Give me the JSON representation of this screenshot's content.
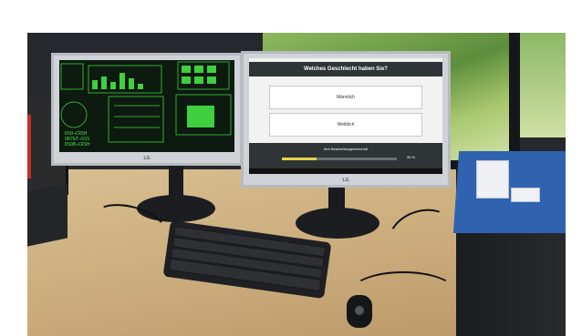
{
  "scene": {
    "description_alt": ""
  },
  "left_monitor": {
    "brand": "LG",
    "screen_lines": [
      "DSO→CRSH",
      "OR7&T→SSS",
      "DSOB→CRSH"
    ]
  },
  "right_monitor": {
    "brand": "LG",
    "question": "Welches Geschlecht haben Sie?",
    "options": [
      "Männlich",
      "Weiblich"
    ],
    "progress_label": "Ihre Bearbeitungsfortschritt",
    "progress_value": 0.3,
    "progress_text": "30 %"
  },
  "colors": {
    "screen_green": "#4de04d",
    "progress_fill": "#e7d54a",
    "tower_accent": "#c62d22",
    "tower_right": "#2f63b0"
  }
}
